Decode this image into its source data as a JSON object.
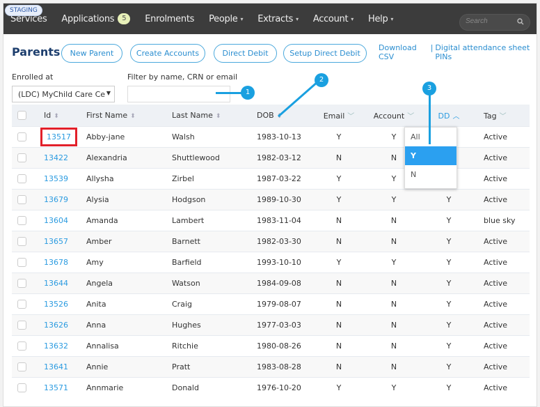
{
  "environment_badge": "STAGING",
  "nav": {
    "items": [
      {
        "label": "Services"
      },
      {
        "label": "Applications",
        "badge": "5"
      },
      {
        "label": "Enrolments"
      },
      {
        "label": "People",
        "caret": "▾"
      },
      {
        "label": "Extracts",
        "caret": "▾"
      },
      {
        "label": "Account",
        "caret": "▾"
      },
      {
        "label": "Help",
        "caret": "▾"
      }
    ],
    "search_placeholder": "Search"
  },
  "page": {
    "title": "Parents",
    "buttons": [
      "New Parent",
      "Create Accounts",
      "Direct Debit",
      "Setup Direct Debit"
    ],
    "links": {
      "download": "Download CSV",
      "separator": "|",
      "pins": "Digital attendance sheet PINs"
    }
  },
  "filters": {
    "enrolled_label": "Enrolled at",
    "enrolled_value": "(LDC) MyChild Care Ce",
    "filter_label": "Filter by name, CRN or email",
    "filter_value": ""
  },
  "table": {
    "columns": [
      {
        "label": "Id",
        "indicator": "⬍"
      },
      {
        "label": "First Name",
        "indicator": "⬍"
      },
      {
        "label": "Last Name",
        "indicator": "⬍"
      },
      {
        "label": "DOB",
        "indicator": "⬍"
      },
      {
        "label": "Email",
        "indicator": "﹀"
      },
      {
        "label": "Account",
        "indicator": "﹀"
      },
      {
        "label": "DD",
        "indicator": "︿"
      },
      {
        "label": "Tag",
        "indicator": "﹀"
      }
    ],
    "rows": [
      {
        "id": "13517",
        "first": "Abby-jane",
        "last": "Walsh",
        "dob": "1983-10-13",
        "email": "Y",
        "account": "Y",
        "dd": "",
        "tag": "Active"
      },
      {
        "id": "13422",
        "first": "Alexandria",
        "last": "Shuttlewood",
        "dob": "1982-03-12",
        "email": "N",
        "account": "N",
        "dd": "",
        "tag": "Active"
      },
      {
        "id": "13539",
        "first": "Allysha",
        "last": "Zirbel",
        "dob": "1987-03-22",
        "email": "Y",
        "account": "Y",
        "dd": "",
        "tag": "Active"
      },
      {
        "id": "13679",
        "first": "Alysia",
        "last": "Hodgson",
        "dob": "1989-10-30",
        "email": "Y",
        "account": "Y",
        "dd": "Y",
        "tag": "Active"
      },
      {
        "id": "13604",
        "first": "Amanda",
        "last": "Lambert",
        "dob": "1983-11-04",
        "email": "N",
        "account": "N",
        "dd": "Y",
        "tag": "blue sky"
      },
      {
        "id": "13657",
        "first": "Amber",
        "last": "Barnett",
        "dob": "1982-03-30",
        "email": "N",
        "account": "N",
        "dd": "Y",
        "tag": "Active"
      },
      {
        "id": "13678",
        "first": "Amy",
        "last": "Barfield",
        "dob": "1993-10-10",
        "email": "Y",
        "account": "Y",
        "dd": "Y",
        "tag": "Active"
      },
      {
        "id": "13644",
        "first": "Angela",
        "last": "Watson",
        "dob": "1984-09-08",
        "email": "N",
        "account": "N",
        "dd": "Y",
        "tag": "Active"
      },
      {
        "id": "13526",
        "first": "Anita",
        "last": "Craig",
        "dob": "1979-08-07",
        "email": "N",
        "account": "N",
        "dd": "Y",
        "tag": "Active"
      },
      {
        "id": "13626",
        "first": "Anna",
        "last": "Hughes",
        "dob": "1977-03-03",
        "email": "N",
        "account": "N",
        "dd": "Y",
        "tag": "Active"
      },
      {
        "id": "13632",
        "first": "Annalisa",
        "last": "Ritchie",
        "dob": "1980-08-26",
        "email": "N",
        "account": "N",
        "dd": "Y",
        "tag": "Active"
      },
      {
        "id": "13641",
        "first": "Annie",
        "last": "Pratt",
        "dob": "1983-08-28",
        "email": "N",
        "account": "N",
        "dd": "Y",
        "tag": "Active"
      },
      {
        "id": "13571",
        "first": "Annmarie",
        "last": "Donald",
        "dob": "1976-10-20",
        "email": "Y",
        "account": "Y",
        "dd": "Y",
        "tag": "Active"
      }
    ]
  },
  "dd_dropdown": {
    "options": [
      "All",
      "Y",
      "N"
    ],
    "selected": "Y"
  },
  "annotations": [
    "1",
    "2",
    "3"
  ],
  "colors": {
    "accent": "#2b9be0",
    "annotation": "#1aa0e0",
    "highlight": "#e2202a",
    "topbar": "#3c3c3c"
  }
}
